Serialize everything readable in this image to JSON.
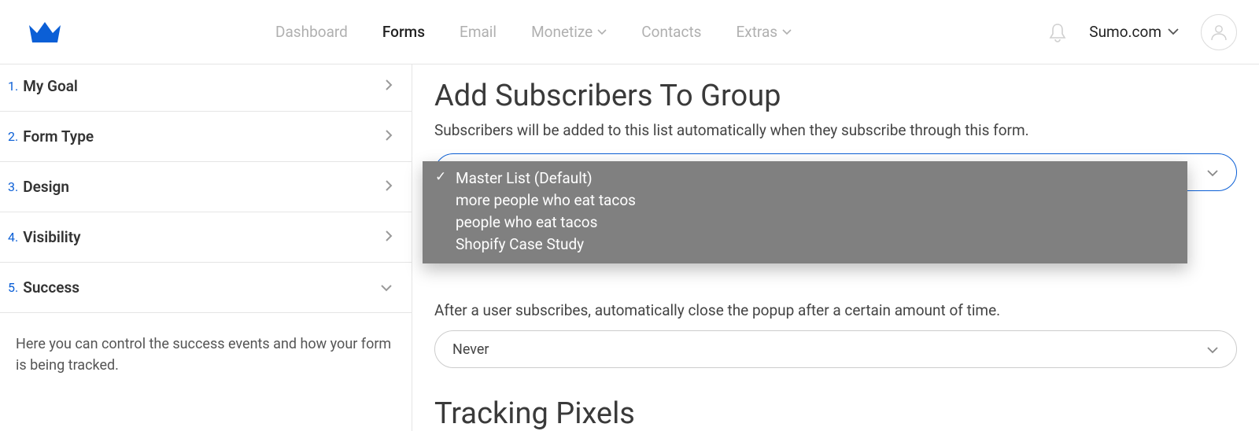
{
  "header": {
    "nav": [
      "Dashboard",
      "Forms",
      "Email",
      "Monetize",
      "Contacts",
      "Extras"
    ],
    "site": "Sumo.com"
  },
  "sidebar": {
    "steps": [
      {
        "num": "1.",
        "label": "My Goal"
      },
      {
        "num": "2.",
        "label": "Form Type"
      },
      {
        "num": "3.",
        "label": "Design"
      },
      {
        "num": "4.",
        "label": "Visibility"
      },
      {
        "num": "5.",
        "label": "Success"
      }
    ],
    "helper": "Here you can control the success events and how your form is being tracked."
  },
  "main": {
    "group_heading": "Add Subscribers To Group",
    "group_desc": "Subscribers will be added to this list automatically when they subscribe through this form.",
    "group_options": [
      "Master List (Default)",
      "more people who eat tacos",
      "people who eat tacos",
      "Shopify Case Study"
    ],
    "group_selected_index": 0,
    "close_desc": "After a user subscribes, automatically close the popup after a certain amount of time.",
    "close_value": "Never",
    "tracking_heading": "Tracking Pixels"
  }
}
